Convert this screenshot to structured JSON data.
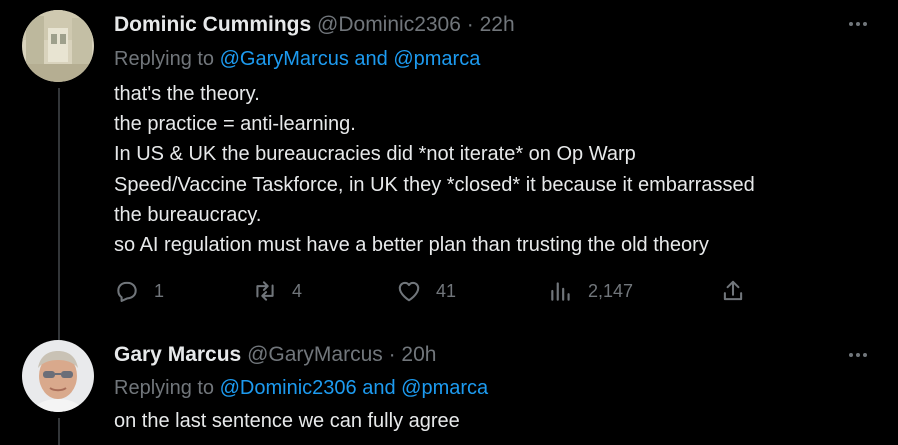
{
  "tweets": [
    {
      "author": {
        "name": "Dominic Cummings",
        "handle": "@Dominic2306",
        "time": "22h"
      },
      "reply": {
        "prefix": "Replying to ",
        "mention1": "@GaryMarcus",
        "and": " and ",
        "mention2": "@pmarca"
      },
      "lines": [
        "that's the theory.",
        "the practice = anti-learning.",
        "In US & UK the bureaucracies did *not iterate* on  Op Warp",
        "Speed/Vaccine Taskforce, in UK they *closed* it because it embarrassed",
        "the bureaucracy.",
        "so AI regulation must have a better plan than trusting the old theory"
      ],
      "stats": {
        "replies": "1",
        "retweets": "4",
        "likes": "41",
        "views": "2,147"
      }
    },
    {
      "author": {
        "name": "Gary Marcus",
        "handle": "@GaryMarcus",
        "time": "20h"
      },
      "reply": {
        "prefix": "Replying to ",
        "mention1": "@Dominic2306",
        "and": " and ",
        "mention2": "@pmarca"
      },
      "lines": [
        "on the last sentence we can fully agree"
      ]
    }
  ],
  "separator": " · ",
  "icons": {
    "more": "more-horizontal-icon",
    "reply": "reply-icon",
    "retweet": "retweet-icon",
    "like": "heart-icon",
    "views": "views-icon",
    "share": "share-icon"
  },
  "colors": {
    "background": "#000000",
    "text": "#e7e9ea",
    "muted": "#71767b",
    "link": "#1d9bf0",
    "thread_line": "#333639"
  }
}
